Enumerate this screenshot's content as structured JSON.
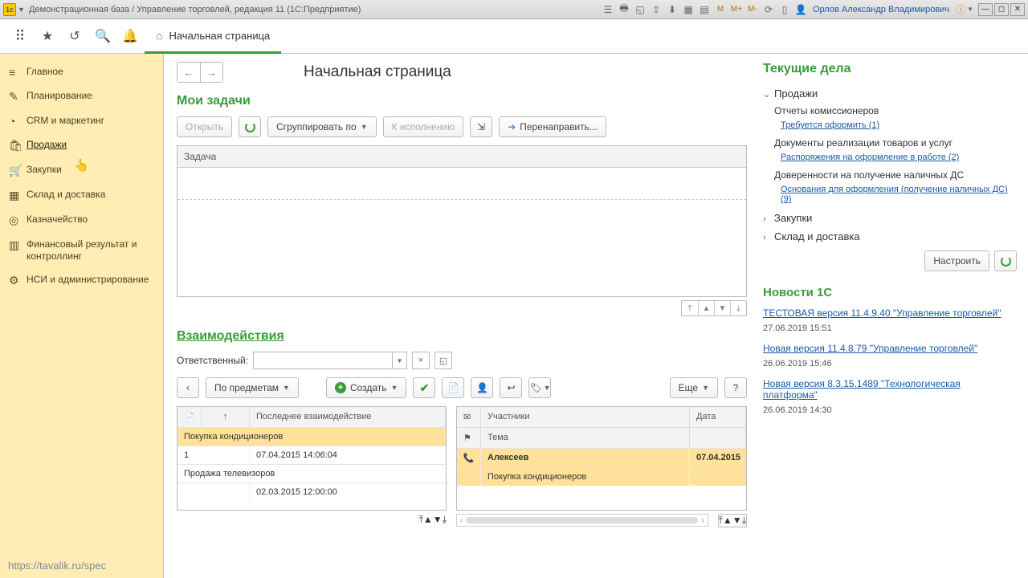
{
  "titlebar": {
    "title": "Демонстрационная база / Управление торговлей, редакция 11 (1С:Предприятие)",
    "user": "Орлов Александр Владимирович"
  },
  "topbar": {
    "tab_home": "Начальная страница"
  },
  "sidebar": {
    "items": [
      {
        "label": "Главное"
      },
      {
        "label": "Планирование"
      },
      {
        "label": "CRM и маркетинг"
      },
      {
        "label": "Продажи"
      },
      {
        "label": "Закупки"
      },
      {
        "label": "Склад и доставка"
      },
      {
        "label": "Казначейство"
      },
      {
        "label": "Финансовый результат и контроллинг"
      },
      {
        "label": "НСИ и администрирование"
      }
    ],
    "footer": "https://tavalik.ru/spec"
  },
  "page": {
    "title": "Начальная страница"
  },
  "tasks": {
    "title": "Мои задачи",
    "open": "Открыть",
    "group_by": "Сгруппировать по",
    "due": "К исполнению",
    "redirect": "Перенаправить...",
    "col_task": "Задача"
  },
  "interactions": {
    "title": "Взаимодействия",
    "responsible": "Ответственный:",
    "by_subject": "По предметам",
    "create": "Создать",
    "more": "Еще",
    "left_cols": {
      "c2": "↑",
      "c3": "Последнее взаимодействие"
    },
    "left_rows": [
      {
        "c1": "Покупка кондиционеров",
        "c2": "",
        "hl": true,
        "span": true
      },
      {
        "c1": "1",
        "c2": "07.04.2015 14:06:04"
      },
      {
        "c1": "Продажа телевизоров",
        "c2": "",
        "span": true
      },
      {
        "c1": "",
        "c2": "02.03.2015 12:00:00"
      }
    ],
    "right_cols": {
      "c2": "Участники",
      "c3": "Дата"
    },
    "right_cols2": {
      "c2": "Тема"
    },
    "right_rows": [
      {
        "c2": "Алексеев",
        "c3": "07.04.2015",
        "hl": true,
        "icon": "phone"
      },
      {
        "c2": "Покупка кондиционеров",
        "c3": "",
        "hl": true
      }
    ]
  },
  "current": {
    "title": "Текущие дела",
    "group1": "Продажи",
    "g1_items": [
      {
        "t": "Отчеты комиссионеров",
        "link": "Требуется оформить (1)"
      },
      {
        "t": "Документы реализации товаров и услуг",
        "link": "Распоряжения на оформление в работе (2)"
      },
      {
        "t": "Доверенности на получение наличных ДС",
        "link": "Основания для оформления (получение наличных ДС) (9)"
      }
    ],
    "group2": "Закупки",
    "group3": "Склад и доставка",
    "configure": "Настроить"
  },
  "news": {
    "title": "Новости 1С",
    "items": [
      {
        "link": "ТЕСТОВАЯ версия 11.4.9.40 \"Управление торговлей\"",
        "date": "27.06.2019 15:51"
      },
      {
        "link": "Новая версия 11.4.8.79 \"Управление торговлей\"",
        "date": "26.06.2019 15:46"
      },
      {
        "link": "Новая версия 8.3.15.1489 \"Технологическая платформа\"",
        "date": "26.06.2019 14:30"
      }
    ]
  }
}
